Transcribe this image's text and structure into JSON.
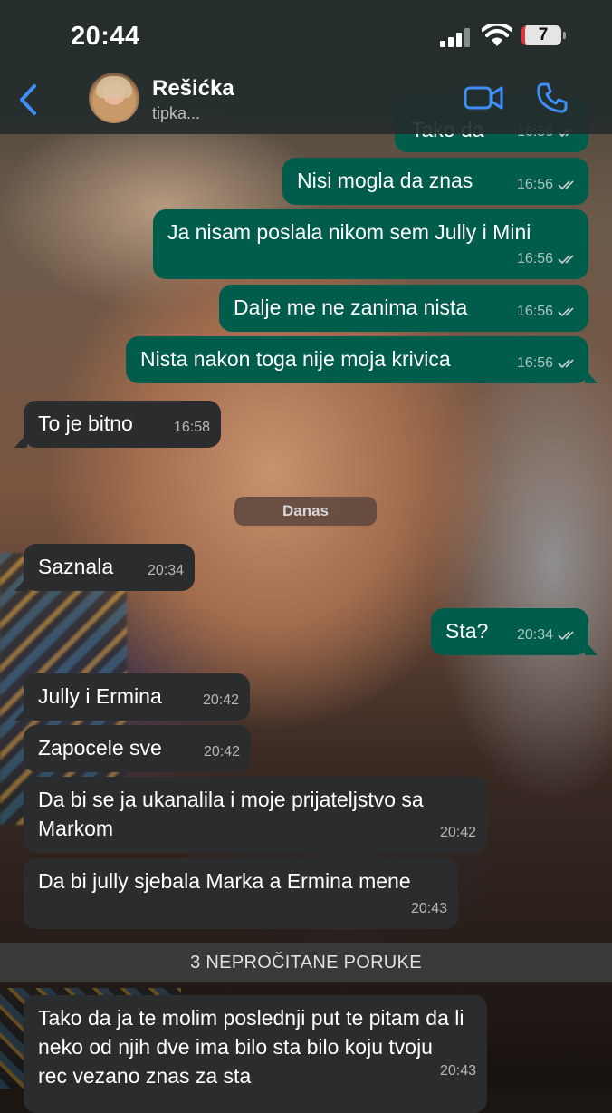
{
  "status_bar": {
    "time": "20:44",
    "battery": "7"
  },
  "header": {
    "contact_name": "Rešićka",
    "contact_status": "tipka..."
  },
  "messages": [
    {
      "dir": "out",
      "text": "Tako da",
      "time": "16:56"
    },
    {
      "dir": "out",
      "text": "Nisi mogla da znas",
      "time": "16:56"
    },
    {
      "dir": "out",
      "text": "Ja nisam poslala nikom sem Jully i Mini",
      "time": "16:56"
    },
    {
      "dir": "out",
      "text": "Dalje me ne zanima nista",
      "time": "16:56"
    },
    {
      "dir": "out",
      "text": "Nista nakon toga nije moja krivica",
      "time": "16:56"
    },
    {
      "dir": "in",
      "text": "To je bitno",
      "time": "16:58"
    },
    {
      "dir": "in",
      "text": "Saznala",
      "time": "20:34"
    },
    {
      "dir": "out",
      "text": "Sta?",
      "time": "20:34"
    },
    {
      "dir": "in",
      "text": "Jully i Ermina",
      "time": "20:42"
    },
    {
      "dir": "in",
      "text": "Zapocele sve",
      "time": "20:42"
    },
    {
      "dir": "in",
      "text": "Da bi se ja ukanalila i moje prijateljstvo sa Markom",
      "time": "20:42"
    },
    {
      "dir": "in",
      "text": "Da bi jully sjebala Marka a Ermina mene",
      "time": "20:43"
    },
    {
      "dir": "in",
      "text": "Tako da ja te molim poslednji put te pitam da li neko od njih dve ima bilo sta bilo koju tvoju rec vezano znas za sta",
      "time": "20:43"
    }
  ],
  "date_separator": "Danas",
  "unread_banner": "3 NEPROČITANE PORUKE",
  "icons": {
    "back": "chevron-left-icon",
    "video": "video-call-icon",
    "phone": "phone-icon",
    "read_receipt": "double-check-icon"
  },
  "colors": {
    "outgoing_bubble": "#005c4b",
    "incoming_bubble": "#2a2c2e",
    "accent": "#3e8ff7"
  }
}
